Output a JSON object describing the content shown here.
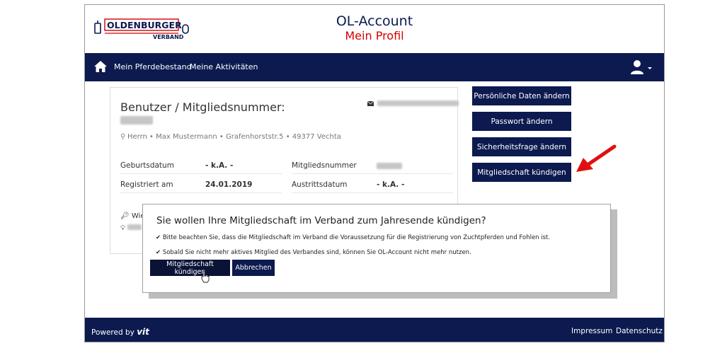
{
  "header": {
    "logo_text": "OLDENBURGER",
    "logo_sub": "VERBAND",
    "title": "OL-Account",
    "subtitle": "Mein Profil"
  },
  "nav": {
    "home_icon": "home-icon",
    "links": [
      "Mein Pferdebestand",
      "Meine Aktivitäten"
    ],
    "user_icon": "user-icon"
  },
  "profile": {
    "title": "Benutzer / Mitgliedsnummer:",
    "address": "Herrn • Max Mustermann • Grafenhorststr.5 • 49377 Vechta",
    "fields": [
      {
        "label": "Geburtsdatum",
        "value": "- k.A. -"
      },
      {
        "label": "Mitgliedsnummer",
        "value": ""
      },
      {
        "label": "Registriert am",
        "value": "24.01.2019"
      },
      {
        "label": "Austrittsdatum",
        "value": "- k.A. -"
      }
    ],
    "key_text": "Wie"
  },
  "actions": [
    "Persönliche Daten ändern",
    "Passwort ändern",
    "Sicherheitsfrage ändern",
    "Mitgliedschaft kündigen"
  ],
  "modal": {
    "title": "Sie wollen Ihre Mitgliedschaft im Verband zum Jahresende kündigen?",
    "notes": [
      "Bitte beachten Sie, dass die Mitgliedschaft im Verband die Voraussetzung für die Registrierung von Zuchtpferden und Fohlen ist.",
      "Sobald Sie nicht mehr aktives Mitglied des Verbandes sind, können Sie OL-Account nicht mehr nutzen."
    ],
    "confirm_label": "Mitgliedschaft kündigen",
    "cancel_label": "Abbrechen"
  },
  "footer": {
    "powered_by": "Powered by",
    "brand": "vit",
    "links": [
      "Impressum",
      "Datenschutz"
    ]
  },
  "colors": {
    "navy": "#0c1a4f",
    "title_red": "#d40000",
    "arrow_red": "#e01010"
  }
}
